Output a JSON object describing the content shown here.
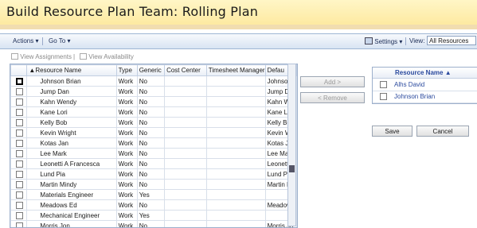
{
  "page": {
    "title": "Build Resource Plan Team: Rolling Plan"
  },
  "menu": {
    "actions": "Actions",
    "goto": "Go To",
    "settings": "Settings",
    "view_label": "View:",
    "view_value": "All Resources"
  },
  "subtoolbar": {
    "view_assignments": "View Assignments",
    "separator": "|",
    "view_availability": "View Availability"
  },
  "grid": {
    "columns": [
      "Resource Name",
      "Type",
      "Generic",
      "Cost Center",
      "Timesheet Manager",
      "Defau"
    ],
    "rows": [
      {
        "name": "Johnson Brian",
        "type": "Work",
        "generic": "No",
        "cost": "",
        "tsm": "",
        "def": "Johnson"
      },
      {
        "name": "Jump Dan",
        "type": "Work",
        "generic": "No",
        "cost": "",
        "tsm": "",
        "def": "Jump De"
      },
      {
        "name": "Kahn Wendy",
        "type": "Work",
        "generic": "No",
        "cost": "",
        "tsm": "",
        "def": "Kahn W"
      },
      {
        "name": "Kane Lori",
        "type": "Work",
        "generic": "No",
        "cost": "",
        "tsm": "",
        "def": "Kane Lo"
      },
      {
        "name": "Kelly Bob",
        "type": "Work",
        "generic": "No",
        "cost": "",
        "tsm": "",
        "def": "Kelly Bo"
      },
      {
        "name": "Kevin Wright",
        "type": "Work",
        "generic": "No",
        "cost": "",
        "tsm": "",
        "def": "Kevin W"
      },
      {
        "name": "Kotas Jan",
        "type": "Work",
        "generic": "No",
        "cost": "",
        "tsm": "",
        "def": "Kotas Ja"
      },
      {
        "name": "Lee Mark",
        "type": "Work",
        "generic": "No",
        "cost": "",
        "tsm": "",
        "def": "Lee Mar"
      },
      {
        "name": "Leonetti A Francesca",
        "type": "Work",
        "generic": "No",
        "cost": "",
        "tsm": "",
        "def": "Leonetti"
      },
      {
        "name": "Lund Pia",
        "type": "Work",
        "generic": "No",
        "cost": "",
        "tsm": "",
        "def": "Lund Pia"
      },
      {
        "name": "Martin Mindy",
        "type": "Work",
        "generic": "No",
        "cost": "",
        "tsm": "",
        "def": "Martin M"
      },
      {
        "name": "Materials Engineer",
        "type": "Work",
        "generic": "Yes",
        "cost": "",
        "tsm": "",
        "def": ""
      },
      {
        "name": "Meadows Ed",
        "type": "Work",
        "generic": "No",
        "cost": "",
        "tsm": "",
        "def": "Meadow"
      },
      {
        "name": "Mechanical Engineer",
        "type": "Work",
        "generic": "Yes",
        "cost": "",
        "tsm": "",
        "def": ""
      },
      {
        "name": "Morris Jon",
        "type": "Work",
        "generic": "No",
        "cost": "",
        "tsm": "",
        "def": "Morris Jo"
      }
    ]
  },
  "buttons": {
    "add": "Add >",
    "remove": "< Remove",
    "save": "Save",
    "cancel": "Cancel"
  },
  "team": {
    "header": "Resource Name",
    "members": [
      "Alhs David",
      "Johnson Brian"
    ]
  },
  "colors": {
    "title_bg": "#fdf0b5",
    "link": "#2b4a9e",
    "menu_bg": "#dce6f4"
  },
  "icons": [
    "triangle-up-icon",
    "dropdown-arrow-icon",
    "settings-icon",
    "view-assignments-icon",
    "view-availability-icon"
  ]
}
